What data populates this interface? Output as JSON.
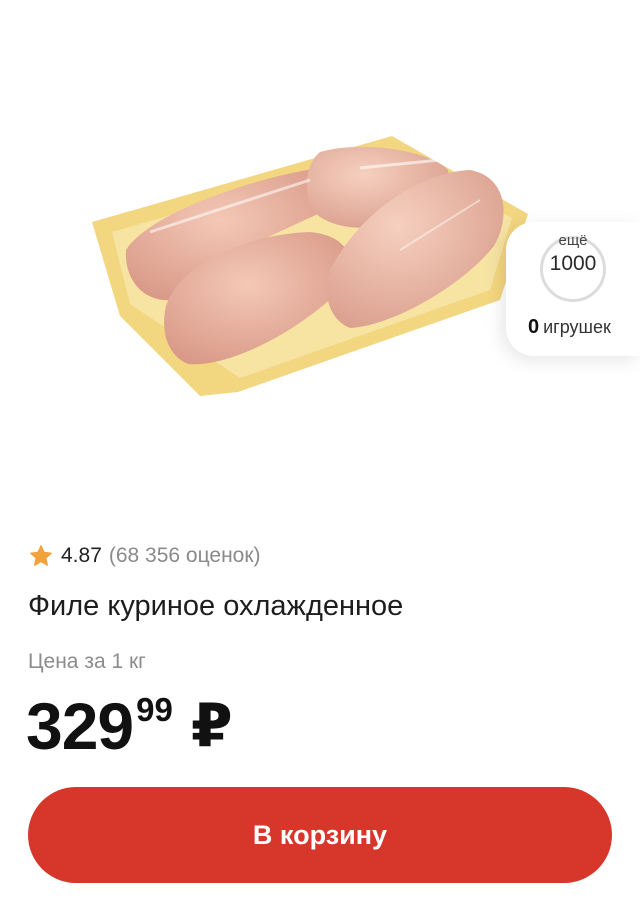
{
  "product": {
    "image_icon": "chicken-fillet-tray-image",
    "rating": "4.87",
    "rating_count": "(68 356 оценок)",
    "title": "Филе куриное охлажденное",
    "unit_label": "Цена за 1 кг",
    "price_int": "329",
    "price_frac": "99",
    "currency": "₽"
  },
  "toy_widget": {
    "more_label": "ещё",
    "target": "1000",
    "count": "0",
    "count_label": "игрушек"
  },
  "cart_button": {
    "label": "В корзину"
  },
  "colors": {
    "accent": "#d7362b",
    "star": "#f2a23a",
    "muted_text": "#8a8a8a"
  }
}
